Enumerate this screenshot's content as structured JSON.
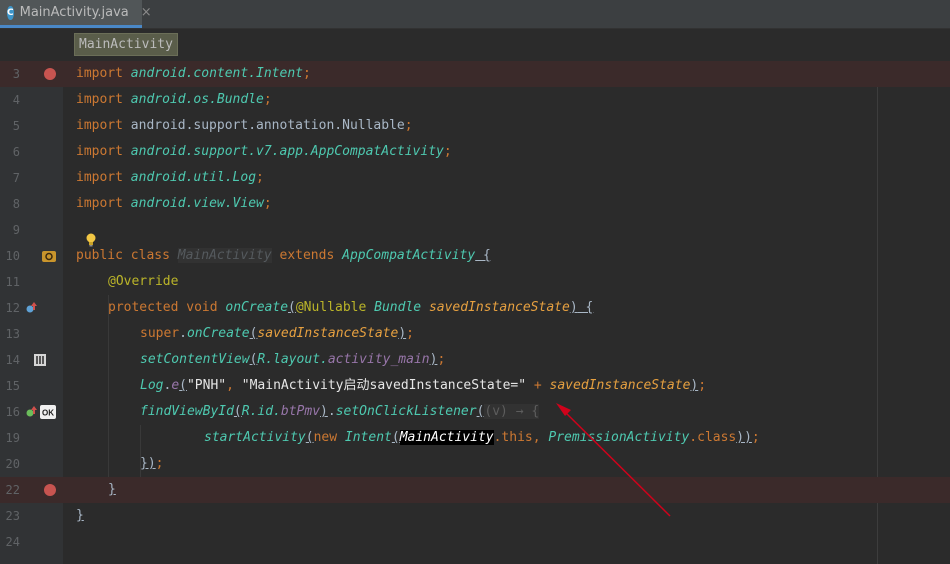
{
  "tab": {
    "icon_letter": "C",
    "filename": "MainActivity.java",
    "close": "×"
  },
  "breadcrumb": "MainActivity",
  "lines": [
    {
      "n": "3",
      "bp": true
    },
    {
      "n": "4"
    },
    {
      "n": "5"
    },
    {
      "n": "6"
    },
    {
      "n": "7"
    },
    {
      "n": "8"
    },
    {
      "n": "9"
    },
    {
      "n": "10",
      "icon": "class-override-icon"
    },
    {
      "n": "11"
    },
    {
      "n": "12",
      "icon": "override-method-icon"
    },
    {
      "n": "13"
    },
    {
      "n": "14",
      "icon": "layout-icon"
    },
    {
      "n": "15"
    },
    {
      "n": "16",
      "icon": "ok-icon"
    },
    {
      "n": "19"
    },
    {
      "n": "20"
    },
    {
      "n": "22",
      "bp": true
    },
    {
      "n": "23"
    },
    {
      "n": "24"
    }
  ],
  "code": {
    "l3": [
      "import",
      " ",
      "android.content.Intent",
      ";"
    ],
    "l4": [
      "import",
      " ",
      "android.os.Bundle",
      ";"
    ],
    "l5": [
      "import",
      " android.support.annotation.Nullable",
      ";"
    ],
    "l6": [
      "import",
      " ",
      "android.support.v7.app.AppCompatActivity",
      ";"
    ],
    "l7": [
      "import",
      " ",
      "android.util.Log",
      ";"
    ],
    "l8": [
      "import",
      " ",
      "android.view.View",
      ";"
    ],
    "l10": [
      "public class ",
      "MainActivity",
      " extends ",
      "AppCompatActivity",
      " {"
    ],
    "l11": [
      "@Override"
    ],
    "l12": [
      "protected void ",
      "onCreate",
      "(",
      "@Nullable ",
      "Bundle",
      " ",
      "savedInstanceState",
      ")",
      " {"
    ],
    "l13": [
      "super",
      ".",
      "onCreate",
      "(",
      "savedInstanceState",
      ")",
      ";"
    ],
    "l14": [
      "setContentView",
      "(",
      "R.layout.",
      "activity_main",
      ")",
      ";"
    ],
    "l15": [
      "Log",
      ".",
      "e",
      "(",
      "\"PNH\"",
      ", ",
      "\"MainActivity启动savedInstanceState=\"",
      " + ",
      "savedInstanceState",
      ")",
      ";"
    ],
    "l16": [
      "findViewById",
      "(",
      "R.id.",
      "btPmv",
      ")",
      ".",
      "setOnClickListener",
      "(",
      "(v) → {"
    ],
    "l19": [
      "startActivity",
      "(",
      "new ",
      "Intent",
      "(",
      "MainActivity",
      ".this",
      ", ",
      "PremissionActivity",
      ".class",
      "))",
      ";"
    ],
    "l20": [
      "})",
      ";"
    ],
    "l22": [
      "}"
    ],
    "l23": [
      "}"
    ]
  },
  "colors": {
    "background": "#2b2b2b",
    "gutter": "#313335",
    "breakpoint": "#c75450",
    "breakpoint_line": "#3b2a2a",
    "arrow": "#d0021b"
  }
}
